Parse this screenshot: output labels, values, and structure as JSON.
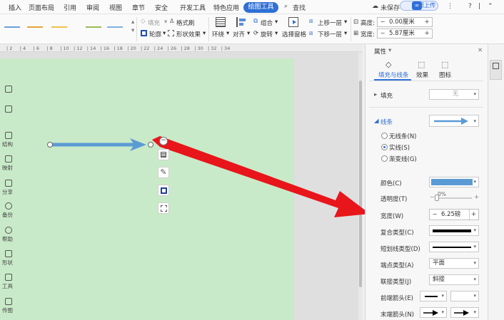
{
  "menu": {
    "items": [
      "插入",
      "页面布局",
      "引用",
      "审阅",
      "视图",
      "章节",
      "安全",
      "开发工具",
      "特色应用"
    ],
    "active_tab": "绘图工具",
    "search": "查找",
    "unsaved": "未保存",
    "upload": "拍照上传",
    "help": "?"
  },
  "ribbon": {
    "fill": "填充",
    "format_brush": "格式刷",
    "outline": "轮廓",
    "shape_effects": "形状效果",
    "wrap": "环绕",
    "align": "对齐",
    "group": "组合",
    "rotate": "旋转",
    "selection_pane": "选择窗格",
    "bring_forward": "上移一层",
    "send_backward": "下移一层",
    "height_label": "高度:",
    "height_value": "0.00厘米",
    "width_label": "宽度:",
    "width_value": "5.87厘米",
    "line_colors": [
      "#6a9fd8",
      "#e8a23c",
      "#f1c14e",
      "#9bbb59",
      "#7fb1e0"
    ]
  },
  "ruler": {
    "ticks": [
      "2",
      "4",
      "6",
      "8",
      "10",
      "12",
      "14",
      "16",
      "18",
      "20",
      "22",
      "24",
      "26",
      "28",
      "30",
      "32",
      "34"
    ]
  },
  "canvas": {
    "arrow_color": "#5b9bd5",
    "page_color": "#c9eac8"
  },
  "panel": {
    "title": "属性",
    "tabs": [
      "填充与线条",
      "效果",
      "图标"
    ],
    "fill": {
      "label": "填充",
      "value": "无"
    },
    "line": {
      "label": "线条"
    },
    "line_options": [
      "无线条(N)",
      "实线(S)",
      "渐变线(G)"
    ],
    "color": {
      "label": "颜色(C)",
      "swatch": "#5b9bd5"
    },
    "transparency": {
      "label": "透明度(T)",
      "value": "0%",
      "level": 0
    },
    "width": {
      "label": "宽度(W)",
      "value": "6.25磅"
    },
    "compound": {
      "label": "复合类型(C)"
    },
    "dash": {
      "label": "短划线类型(D)"
    },
    "cap": {
      "label": "端点类型(A)",
      "value": "平面"
    },
    "join": {
      "label": "联接类型(J)",
      "value": "斜接"
    },
    "begin_arrow": {
      "label": "前端箭头(E)"
    },
    "end_arrow": {
      "label": "末端箭头(N)"
    }
  },
  "sidebar": {
    "items": [
      "结构",
      "映射",
      "分享",
      "备份",
      "帮助",
      "形状",
      "工具",
      "传图"
    ]
  },
  "annotation": {
    "color": "#e8151b"
  }
}
